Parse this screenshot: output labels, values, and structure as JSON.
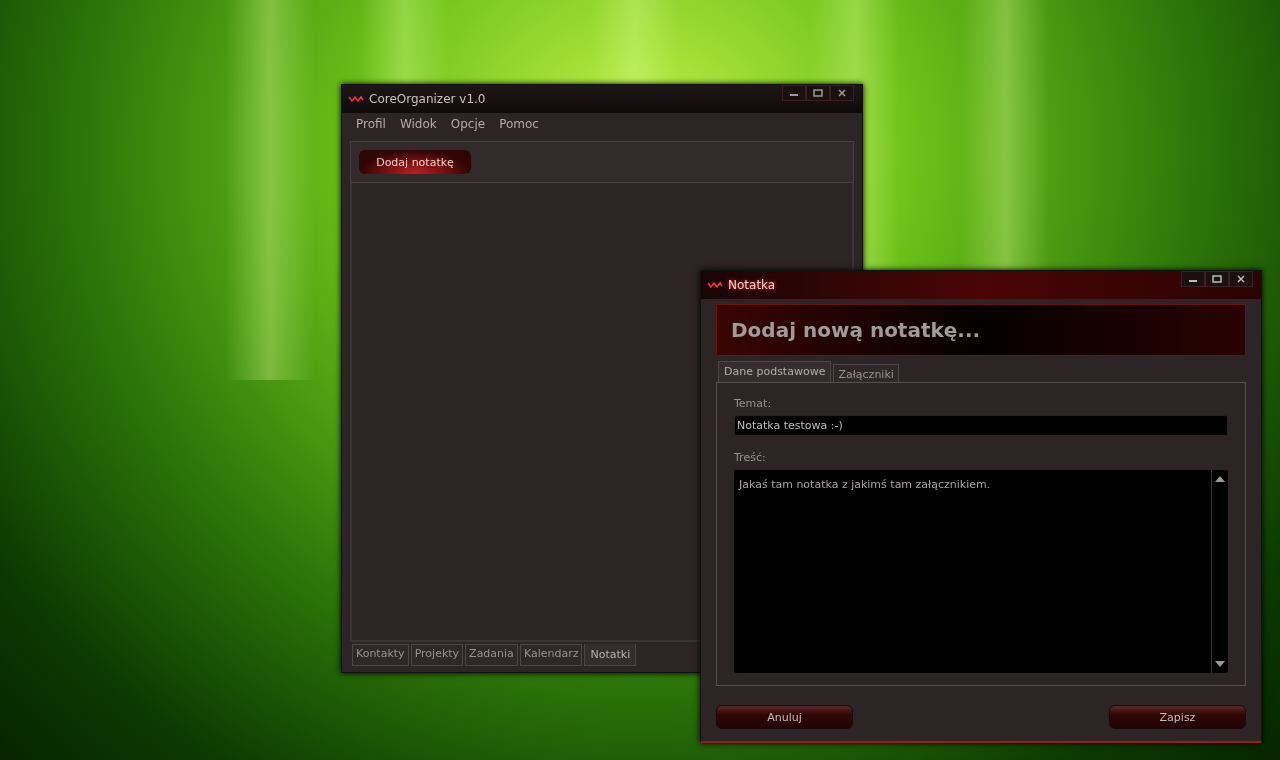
{
  "main_window": {
    "title": "CoreOrganizer v1.0",
    "menu": [
      "Profil",
      "Widok",
      "Opcje",
      "Pomoc"
    ],
    "toolbar_button": "Dodaj notatkę",
    "tabs": [
      {
        "label": "Kontakty",
        "selected": false
      },
      {
        "label": "Projekty",
        "selected": false
      },
      {
        "label": "Zadania",
        "selected": false
      },
      {
        "label": "Kalendarz",
        "selected": false
      },
      {
        "label": "Notatki",
        "selected": true
      }
    ]
  },
  "dialog": {
    "title": "Notatka",
    "heading": "Dodaj nową notatkę...",
    "tabs": [
      {
        "label": "Dane podstawowe",
        "selected": true
      },
      {
        "label": "Załączniki",
        "selected": false
      }
    ],
    "subject_label": "Temat:",
    "subject_value": "Notatka testowa :-)",
    "content_label": "Treść:",
    "content_value": "Jakaś tam notatka z jakimś tam załącznikiem.",
    "buttons": [
      "Anuluj",
      "Zapisz"
    ]
  }
}
